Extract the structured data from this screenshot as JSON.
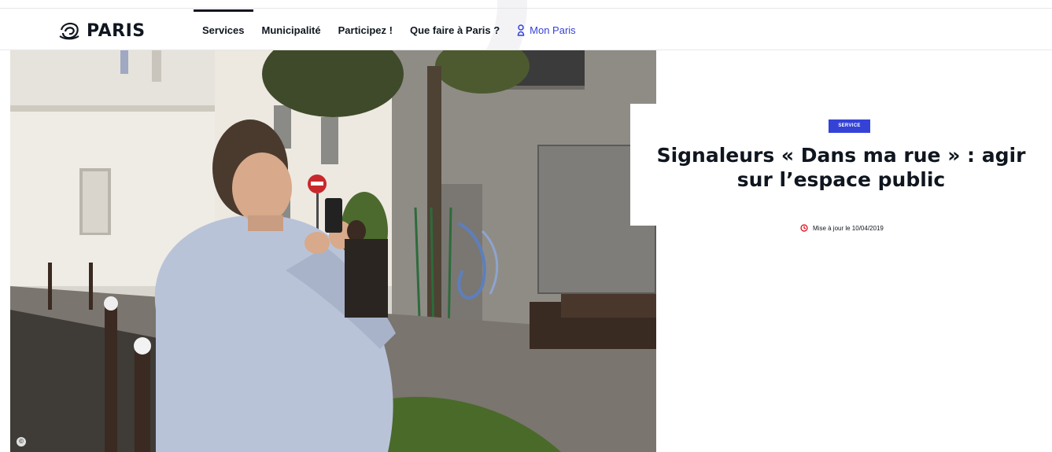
{
  "header": {
    "logo_text": "PARIS",
    "nav": [
      {
        "label": "Services",
        "active": true
      },
      {
        "label": "Municipalité",
        "active": false
      },
      {
        "label": "Participez !",
        "active": false
      },
      {
        "label": "Que faire à Paris ?",
        "active": false
      },
      {
        "label": "Mon Paris",
        "active": false,
        "icon": "person-icon"
      }
    ]
  },
  "hero": {
    "copyright_mark": "©",
    "image_subject": "man-photographing-street-with-phone"
  },
  "article": {
    "tag": "SERVICE",
    "title_line1": "Signaleurs « Dans ma rue » : agir",
    "title_line2": "sur l’espace public",
    "updated": "Mise à jour le 10/04/2019"
  },
  "colors": {
    "brand_blue": "#3443d6",
    "text_dark": "#10161f",
    "clock_red": "#e1000f"
  }
}
